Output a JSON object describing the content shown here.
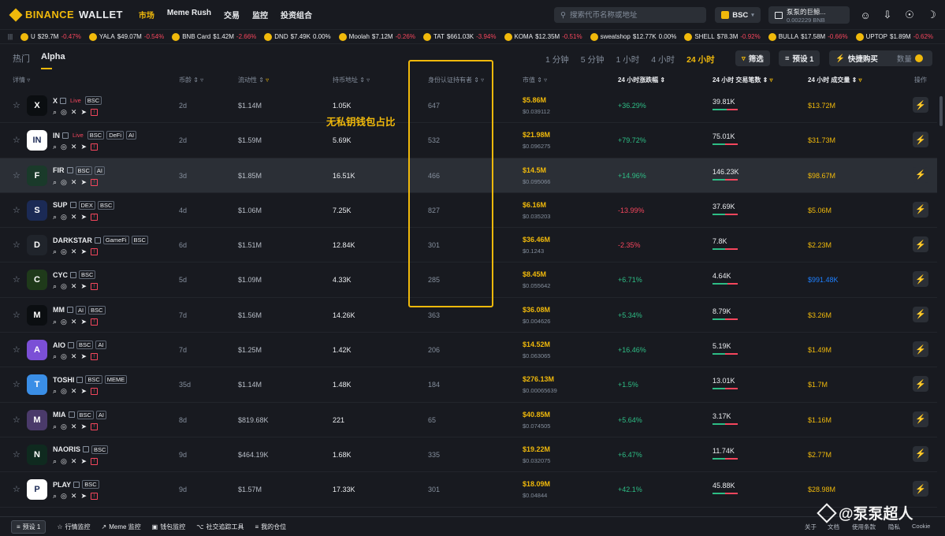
{
  "brand": {
    "name": "BINANCE",
    "suffix": "WALLET"
  },
  "nav": [
    {
      "label": "市场",
      "active": true
    },
    {
      "label": "Meme Rush",
      "active": false
    },
    {
      "label": "交易",
      "active": false
    },
    {
      "label": "监控",
      "active": false
    },
    {
      "label": "投资组合",
      "active": false
    }
  ],
  "search": {
    "placeholder": "搜索代币名称或地址"
  },
  "chain": {
    "label": "BSC"
  },
  "account": {
    "name": "泵泵的巨鲸...",
    "balance": "0.002229 BNB"
  },
  "ticker": [
    {
      "name": "U",
      "price": "$29.7M",
      "change": "-0.47%",
      "dir": "dn"
    },
    {
      "name": "YALA",
      "price": "$49.07M",
      "change": "-0.54%",
      "dir": "dn"
    },
    {
      "name": "BNB Card",
      "price": "$1.42M",
      "change": "-2.66%",
      "dir": "dn"
    },
    {
      "name": "DND",
      "price": "$7.49K",
      "change": "0.00%",
      "dir": "ne"
    },
    {
      "name": "Moolah",
      "price": "$7.12M",
      "change": "-0.26%",
      "dir": "dn"
    },
    {
      "name": "TAT",
      "price": "$661.03K",
      "change": "-3.94%",
      "dir": "dn"
    },
    {
      "name": "KOMA",
      "price": "$12.35M",
      "change": "-0.51%",
      "dir": "dn"
    },
    {
      "name": "sweatshop",
      "price": "$12.77K",
      "change": "0.00%",
      "dir": "ne"
    },
    {
      "name": "SHELL",
      "price": "$78.3M",
      "change": "-0.92%",
      "dir": "dn"
    },
    {
      "name": "BULLA",
      "price": "$17.58M",
      "change": "-0.66%",
      "dir": "dn"
    },
    {
      "name": "UPTOP",
      "price": "$1.89M",
      "change": "-0.62%",
      "dir": "dn"
    }
  ],
  "tabs": [
    {
      "label": "热门",
      "active": false
    },
    {
      "label": "Alpha",
      "active": true
    }
  ],
  "periods": [
    {
      "label": "1 分钟",
      "active": false
    },
    {
      "label": "5 分钟",
      "active": false
    },
    {
      "label": "1 小时",
      "active": false
    },
    {
      "label": "4 小时",
      "active": false
    },
    {
      "label": "24 小时",
      "active": true
    }
  ],
  "buttons": {
    "filter": "筛选",
    "preset": "预设 1",
    "quick_buy": "快捷购买",
    "quantity": "数量"
  },
  "headers": {
    "detail": "详情",
    "age": "币龄",
    "liquidity": "流动性",
    "holders": "持币地址",
    "kyc": "身份认证持有者",
    "mcap": "市值",
    "change": "24 小时涨跌幅",
    "txs": "24 小时 交易笔数",
    "volume": "24 小时 成交量",
    "action": "操作"
  },
  "rows": [
    {
      "symbol": "X",
      "tags": [
        "Live",
        "BSC"
      ],
      "age": "2d",
      "liquidity": "$1.14M",
      "holders": "1.05K",
      "kyc": "647",
      "mcap": "$5.86M",
      "price": "$0.039112",
      "change": "+36.29%",
      "dir": "up",
      "txs": "39.81K",
      "buy_ratio": 0.55,
      "volume": "$13.72M",
      "avatar_color": "#0b0e11",
      "avatar_text": "X"
    },
    {
      "symbol": "IN",
      "tags": [
        "Live",
        "BSC",
        "DeFi",
        "AI"
      ],
      "age": "2d",
      "liquidity": "$1.59M",
      "holders": "5.69K",
      "kyc": "532",
      "mcap": "$21.98M",
      "price": "$0.096275",
      "change": "+79.72%",
      "dir": "up",
      "txs": "75.01K",
      "buy_ratio": 0.5,
      "volume": "$31.73M",
      "avatar_color": "#ffffff",
      "avatar_text": "IN"
    },
    {
      "symbol": "FIR",
      "tags": [
        "BSC",
        "AI"
      ],
      "age": "3d",
      "liquidity": "$1.85M",
      "holders": "16.51K",
      "kyc": "466",
      "mcap": "$14.5M",
      "price": "$0.095066",
      "change": "+14.96%",
      "dir": "up",
      "txs": "146.23K",
      "buy_ratio": 0.5,
      "volume": "$98.67M",
      "avatar_color": "#1a3a2a",
      "avatar_text": "F"
    },
    {
      "symbol": "SUP",
      "tags": [
        "DEX",
        "BSC"
      ],
      "age": "4d",
      "liquidity": "$1.06M",
      "holders": "7.25K",
      "kyc": "827",
      "mcap": "$6.16M",
      "price": "$0.035203",
      "change": "-13.99%",
      "dir": "dn",
      "txs": "37.69K",
      "buy_ratio": 0.5,
      "volume": "$5.06M",
      "avatar_color": "#1b2a55",
      "avatar_text": "S"
    },
    {
      "symbol": "DARKSTAR",
      "tags": [
        "GameFi",
        "BSC"
      ],
      "age": "6d",
      "liquidity": "$1.51M",
      "holders": "12.84K",
      "kyc": "301",
      "mcap": "$36.46M",
      "price": "$0.1243",
      "change": "-2.35%",
      "dir": "dn",
      "txs": "7.8K",
      "buy_ratio": 0.5,
      "volume": "$2.23M",
      "avatar_color": "#20242b",
      "avatar_text": "D"
    },
    {
      "symbol": "CYC",
      "tags": [
        "BSC"
      ],
      "age": "5d",
      "liquidity": "$1.09M",
      "holders": "4.33K",
      "kyc": "285",
      "mcap": "$8.45M",
      "price": "$0.055642",
      "change": "+6.71%",
      "dir": "up",
      "txs": "4.64K",
      "buy_ratio": 0.6,
      "volume": "$991.48K",
      "avatar_color": "#1f3a1a",
      "avatar_text": "C"
    },
    {
      "symbol": "MM",
      "tags": [
        "AI",
        "BSC"
      ],
      "age": "7d",
      "liquidity": "$1.56M",
      "holders": "14.26K",
      "kyc": "363",
      "mcap": "$36.08M",
      "price": "$0.004626",
      "change": "+5.34%",
      "dir": "up",
      "txs": "8.79K",
      "buy_ratio": 0.5,
      "volume": "$3.26M",
      "avatar_color": "#0b0e11",
      "avatar_text": "M"
    },
    {
      "symbol": "AIO",
      "tags": [
        "BSC",
        "AI"
      ],
      "age": "7d",
      "liquidity": "$1.25M",
      "holders": "1.42K",
      "kyc": "206",
      "mcap": "$14.52M",
      "price": "$0.063065",
      "change": "+16.46%",
      "dir": "up",
      "txs": "5.19K",
      "buy_ratio": 0.5,
      "volume": "$1.49M",
      "avatar_color": "#7b4fd6",
      "avatar_text": "A"
    },
    {
      "symbol": "TOSHI",
      "tags": [
        "BSC",
        "MEME"
      ],
      "age": "35d",
      "liquidity": "$1.14M",
      "holders": "1.48K",
      "kyc": "184",
      "mcap": "$276.13M",
      "price": "$0.00065639",
      "change": "+1.5%",
      "dir": "up",
      "txs": "13.01K",
      "buy_ratio": 0.5,
      "volume": "$1.7M",
      "avatar_color": "#3a8ee6",
      "avatar_text": "T"
    },
    {
      "symbol": "MIA",
      "tags": [
        "BSC",
        "AI"
      ],
      "age": "8d",
      "liquidity": "$819.68K",
      "holders": "221",
      "kyc": "65",
      "mcap": "$40.85M",
      "price": "$0.074505",
      "change": "+5.64%",
      "dir": "up",
      "txs": "3.17K",
      "buy_ratio": 0.5,
      "volume": "$1.16M",
      "avatar_color": "#4a3a6a",
      "avatar_text": "M"
    },
    {
      "symbol": "NAORIS",
      "tags": [
        "BSC"
      ],
      "age": "9d",
      "liquidity": "$464.19K",
      "holders": "1.68K",
      "kyc": "335",
      "mcap": "$19.22M",
      "price": "$0.032075",
      "change": "+6.47%",
      "dir": "up",
      "txs": "11.74K",
      "buy_ratio": 0.5,
      "volume": "$2.77M",
      "avatar_color": "#0f2a1f",
      "avatar_text": "N"
    },
    {
      "symbol": "PLAY",
      "tags": [
        "BSC"
      ],
      "age": "9d",
      "liquidity": "$1.57M",
      "holders": "17.33K",
      "kyc": "301",
      "mcap": "$18.09M",
      "price": "$0.04844",
      "change": "+42.1%",
      "dir": "up",
      "txs": "45.88K",
      "buy_ratio": 0.5,
      "volume": "$28.98M",
      "avatar_color": "#ffffff",
      "avatar_text": "P"
    }
  ],
  "annotation": "无私钥钱包占比",
  "footer": {
    "preset": "预设 1",
    "items": [
      "行情监控",
      "Meme 监控",
      "钱包监控",
      "社交追踪工具",
      "我的仓位"
    ],
    "right": [
      "关于",
      "文档",
      "使用条款",
      "隐私",
      "Cookie"
    ]
  },
  "watermark": "@泵泵超人",
  "colors": {
    "accent": "#f0b90b",
    "up": "#2ebd85",
    "down": "#f6465d",
    "bg": "#181a20"
  }
}
